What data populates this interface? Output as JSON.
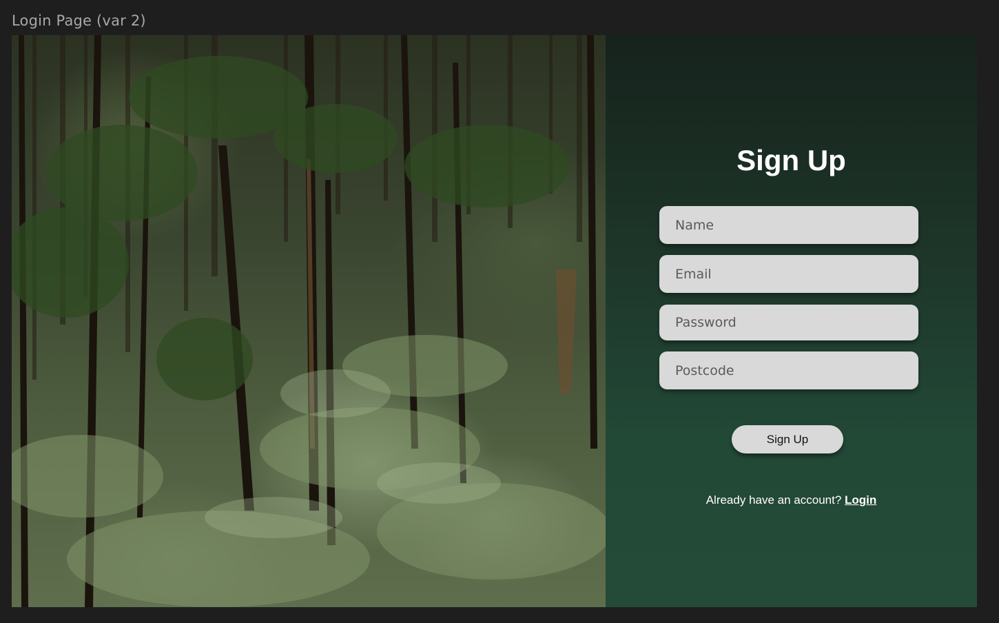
{
  "frame": {
    "label": "Login Page (var 2)"
  },
  "hero_image": {
    "description_icon": "forest-photo"
  },
  "form": {
    "title": "Sign Up",
    "fields": [
      {
        "placeholder": "Name",
        "value": ""
      },
      {
        "placeholder": "Email",
        "value": ""
      },
      {
        "placeholder": "Password",
        "value": ""
      },
      {
        "placeholder": "Postcode",
        "value": ""
      }
    ],
    "submit_label": "Sign Up",
    "login_prompt": "Already have an account?",
    "login_link": "Login"
  },
  "colors": {
    "background": "#1e1e1e",
    "panel_top": "#16231c",
    "panel_bottom": "#244a38",
    "field_bg": "#d9d9d9",
    "text_light": "#ffffff"
  }
}
